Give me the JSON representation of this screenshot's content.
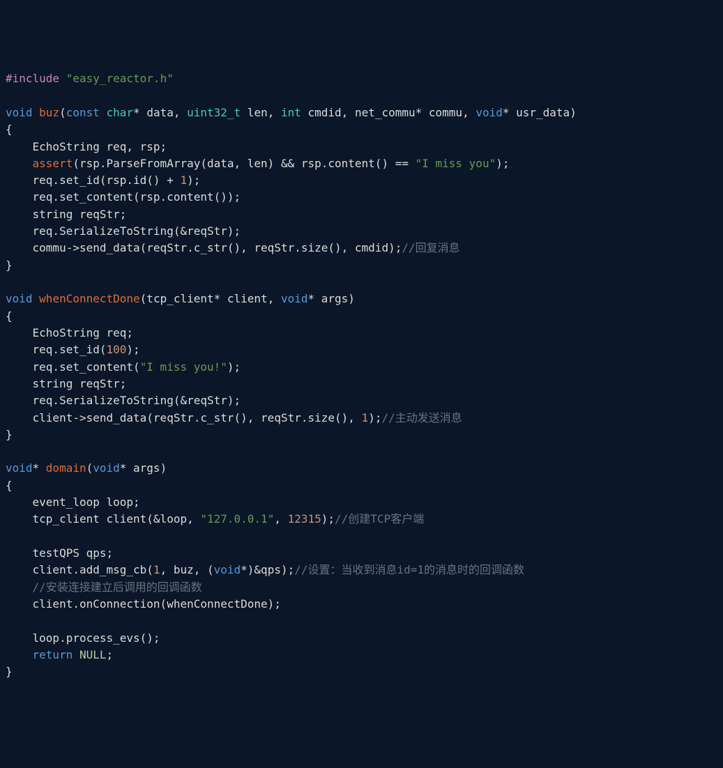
{
  "lines": [
    [
      {
        "t": "#include ",
        "c": "pp"
      },
      {
        "t": "\"easy_reactor.h\"",
        "c": "str"
      }
    ],
    [],
    [
      {
        "t": "void ",
        "c": "kw"
      },
      {
        "t": "buz",
        "c": "fn"
      },
      {
        "t": "(",
        "c": "pl"
      },
      {
        "t": "const ",
        "c": "kw"
      },
      {
        "t": "char",
        "c": "type"
      },
      {
        "t": "* data, ",
        "c": "pl"
      },
      {
        "t": "uint32_t",
        "c": "type"
      },
      {
        "t": " len, ",
        "c": "pl"
      },
      {
        "t": "int",
        "c": "type"
      },
      {
        "t": " cmdid, net_commu* commu, ",
        "c": "pl"
      },
      {
        "t": "void",
        "c": "kw"
      },
      {
        "t": "* usr_data)",
        "c": "pl"
      }
    ],
    [
      {
        "t": "{",
        "c": "pl"
      }
    ],
    [
      {
        "t": "    EchoString req, rsp;",
        "c": "pl"
      }
    ],
    [
      {
        "t": "    ",
        "c": "pl"
      },
      {
        "t": "assert",
        "c": "fn"
      },
      {
        "t": "(rsp.ParseFromArray(data, len) && rsp.content() == ",
        "c": "pl"
      },
      {
        "t": "\"I miss you\"",
        "c": "str"
      },
      {
        "t": ");",
        "c": "pl"
      }
    ],
    [
      {
        "t": "    req.set_id(rsp.id() + ",
        "c": "pl"
      },
      {
        "t": "1",
        "c": "num"
      },
      {
        "t": ");",
        "c": "pl"
      }
    ],
    [
      {
        "t": "    req.set_content(rsp.content());",
        "c": "pl"
      }
    ],
    [
      {
        "t": "    string reqStr;",
        "c": "pl"
      }
    ],
    [
      {
        "t": "    req.SerializeToString(&reqStr);",
        "c": "pl"
      }
    ],
    [
      {
        "t": "    commu->send_data(reqStr.c_str(), reqStr.size(), cmdid);",
        "c": "pl"
      },
      {
        "t": "//回复消息",
        "c": "cmt"
      }
    ],
    [
      {
        "t": "}",
        "c": "pl"
      }
    ],
    [],
    [
      {
        "t": "void ",
        "c": "kw"
      },
      {
        "t": "whenConnectDone",
        "c": "fn"
      },
      {
        "t": "(tcp_client* client, ",
        "c": "pl"
      },
      {
        "t": "void",
        "c": "kw"
      },
      {
        "t": "* args)",
        "c": "pl"
      }
    ],
    [
      {
        "t": "{",
        "c": "pl"
      }
    ],
    [
      {
        "t": "    EchoString req;",
        "c": "pl"
      }
    ],
    [
      {
        "t": "    req.set_id(",
        "c": "pl"
      },
      {
        "t": "100",
        "c": "num"
      },
      {
        "t": ");",
        "c": "pl"
      }
    ],
    [
      {
        "t": "    req.set_content(",
        "c": "pl"
      },
      {
        "t": "\"I miss you!\"",
        "c": "str"
      },
      {
        "t": ");",
        "c": "pl"
      }
    ],
    [
      {
        "t": "    string reqStr;",
        "c": "pl"
      }
    ],
    [
      {
        "t": "    req.SerializeToString(&reqStr);",
        "c": "pl"
      }
    ],
    [
      {
        "t": "    client->send_data(reqStr.c_str(), reqStr.size(), ",
        "c": "pl"
      },
      {
        "t": "1",
        "c": "num"
      },
      {
        "t": ");",
        "c": "pl"
      },
      {
        "t": "//主动发送消息",
        "c": "cmt"
      }
    ],
    [
      {
        "t": "}",
        "c": "pl"
      }
    ],
    [],
    [
      {
        "t": "void",
        "c": "kw"
      },
      {
        "t": "* ",
        "c": "pl"
      },
      {
        "t": "domain",
        "c": "fn"
      },
      {
        "t": "(",
        "c": "pl"
      },
      {
        "t": "void",
        "c": "kw"
      },
      {
        "t": "* args)",
        "c": "pl"
      }
    ],
    [
      {
        "t": "{",
        "c": "pl"
      }
    ],
    [
      {
        "t": "    event_loop loop;",
        "c": "pl"
      }
    ],
    [
      {
        "t": "    tcp_client client(&loop, ",
        "c": "pl"
      },
      {
        "t": "\"127.0.0.1\"",
        "c": "str"
      },
      {
        "t": ", ",
        "c": "pl"
      },
      {
        "t": "12315",
        "c": "num"
      },
      {
        "t": ");",
        "c": "pl"
      },
      {
        "t": "//创建TCP客户端",
        "c": "cmt"
      }
    ],
    [],
    [
      {
        "t": "    testQPS qps;",
        "c": "pl"
      }
    ],
    [
      {
        "t": "    client.add_msg_cb(",
        "c": "pl"
      },
      {
        "t": "1",
        "c": "num"
      },
      {
        "t": ", buz, (",
        "c": "pl"
      },
      {
        "t": "void",
        "c": "kw"
      },
      {
        "t": "*)&qps);",
        "c": "pl"
      },
      {
        "t": "//设置：当收到消息id=1的消息时的回调函数",
        "c": "cmt"
      }
    ],
    [
      {
        "t": "    ",
        "c": "pl"
      },
      {
        "t": "//安装连接建立后调用的回调函数",
        "c": "cmt"
      }
    ],
    [
      {
        "t": "    client.onConnection(whenConnectDone);",
        "c": "pl"
      }
    ],
    [],
    [
      {
        "t": "    loop.process_evs();",
        "c": "pl"
      }
    ],
    [
      {
        "t": "    ",
        "c": "pl"
      },
      {
        "t": "return ",
        "c": "kw"
      },
      {
        "t": "NULL",
        "c": "nul"
      },
      {
        "t": ";",
        "c": "pl"
      }
    ],
    [
      {
        "t": "}",
        "c": "pl"
      }
    ]
  ]
}
